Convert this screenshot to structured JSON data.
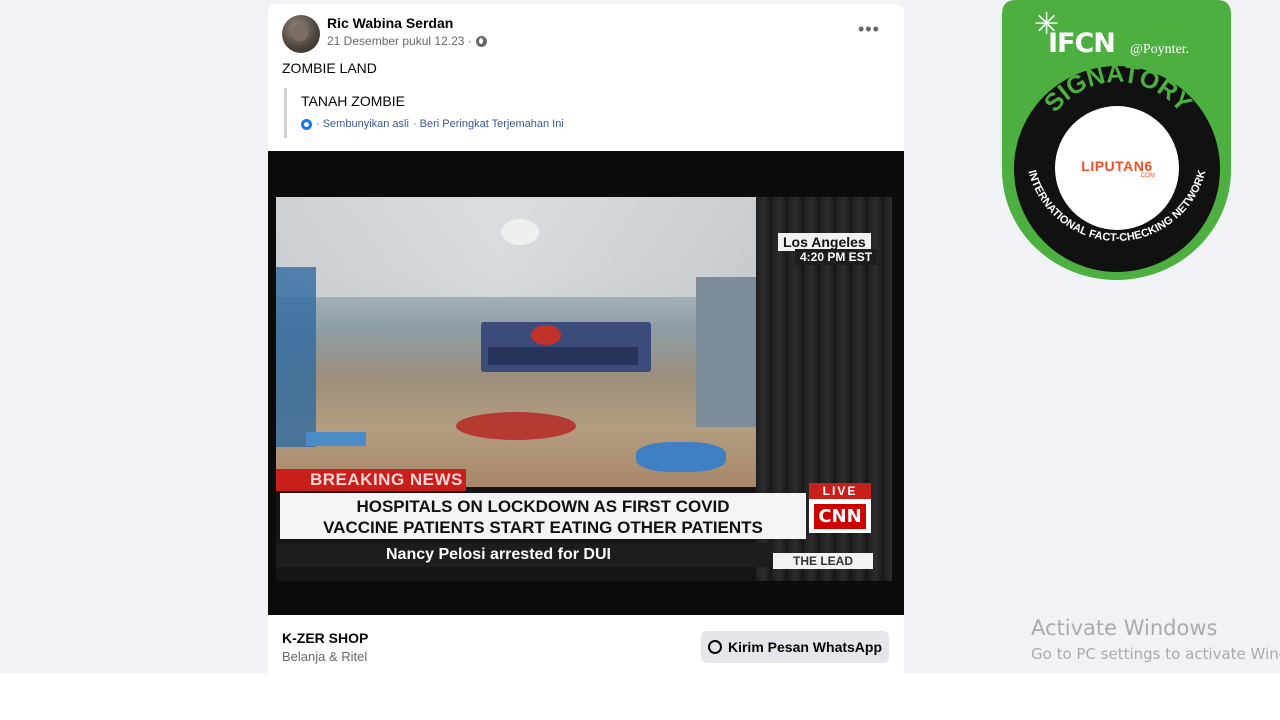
{
  "post": {
    "author": "Ric Wabina Serdan",
    "timestamp": "21 Desember pukul 12.23 ·",
    "visibility_icon": "globe-icon",
    "menu_icon": "more-options-icon",
    "more_label": "•••",
    "text": "ZOMBIE LAND",
    "translation": {
      "text": "TANAH ZOMBIE",
      "hide_original": "· Sembunyikan asli",
      "rate_translation": "· Beri Peringkat Terjemahan Ini"
    }
  },
  "broadcast": {
    "location": "Los Angeles",
    "time": "4:20 PM EST",
    "banner": "BREAKING NEWS",
    "headline_line1": "HOSPITALS ON LOCKDOWN AS FIRST COVID",
    "headline_line2": "VACCINE PATIENTS START EATING OTHER PATIENTS",
    "live_label": "LIVE",
    "network_logo": "CNN",
    "ticker": "Nancy Pelosi arrested for DUI",
    "show_name": "THE LEAD"
  },
  "footer": {
    "shop_name": "K-ZER SHOP",
    "category": "Belanja & Ritel",
    "whatsapp_button": "Kirim Pesan WhatsApp"
  },
  "badge": {
    "org": "IFCN",
    "partner": "@Poynter.",
    "ring_top": "SIGNATORY",
    "ring_bottom": "INTERNATIONAL FACT-CHECKING NETWORK",
    "member_logo": "LIPUTAN6",
    "member_suffix": ".COM",
    "colors": {
      "green": "#4caf3f",
      "black": "#111111",
      "liputan_orange": "#f04e23"
    }
  },
  "system_overlay": {
    "line1": "Activate Windows",
    "line2": "Go to PC settings to activate Windows."
  }
}
